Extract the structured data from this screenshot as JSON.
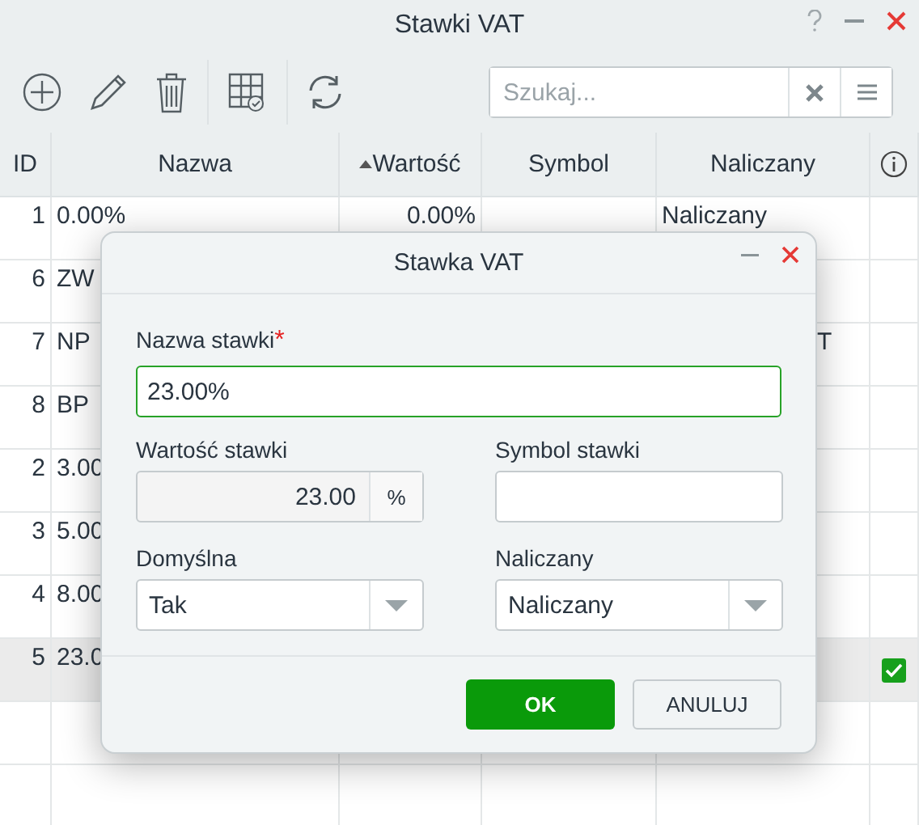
{
  "window": {
    "title": "Stawki VAT"
  },
  "search": {
    "placeholder": "Szukaj..."
  },
  "table": {
    "columns": [
      {
        "label": "ID",
        "sorted": false
      },
      {
        "label": "Nazwa",
        "sorted": false
      },
      {
        "label": "Wartość",
        "sorted": true
      },
      {
        "label": "Symbol",
        "sorted": false
      },
      {
        "label": "Naliczany",
        "sorted": false
      }
    ],
    "rows": [
      {
        "id": "1",
        "name": "0.00%",
        "value": "0.00%",
        "charged": "Naliczany",
        "selected": false,
        "default": false
      },
      {
        "id": "6",
        "name": "ZW",
        "selected": false,
        "default": false
      },
      {
        "id": "7",
        "name": "NP",
        "charged": "T",
        "selected": false,
        "default": false
      },
      {
        "id": "8",
        "name": "BP",
        "selected": false,
        "default": false
      },
      {
        "id": "2",
        "name": "3.00",
        "selected": false,
        "default": false
      },
      {
        "id": "3",
        "name": "5.00",
        "selected": false,
        "default": false
      },
      {
        "id": "4",
        "name": "8.00",
        "selected": false,
        "default": false
      },
      {
        "id": "5",
        "name": "23.0",
        "selected": true,
        "default": true
      }
    ]
  },
  "dialog": {
    "title": "Stawka VAT",
    "name_label": "Nazwa stawki",
    "required_mark": "*",
    "name_value": "23.00%",
    "rate_label": "Wartość stawki",
    "rate_value": "23.00",
    "rate_unit": "%",
    "symbol_label": "Symbol stawki",
    "default_label": "Domyślna",
    "default_value": "Tak",
    "charged_label": "Naliczany",
    "charged_value": "Naliczany",
    "buttons": [
      {
        "label": "OK",
        "kind": "primary"
      },
      {
        "label": "ANULUJ",
        "kind": "secondary"
      }
    ]
  }
}
